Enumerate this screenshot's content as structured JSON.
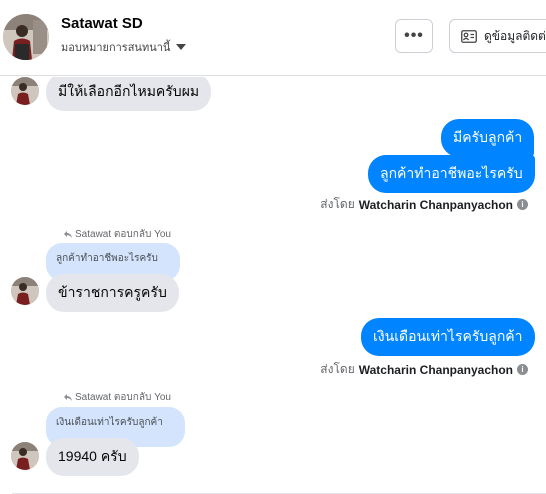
{
  "header": {
    "contact_name": "Satawat SD",
    "assign_label": "มอบหมายการสนทนานี้",
    "more_label": "•••",
    "contact_info_label": "ดูข้อมูลติดต่อ"
  },
  "messages": {
    "m1": "มีให้เลือกอีกไหมครับผม",
    "m2": "มีครับลูกค้า",
    "m3": "ลูกค้าทำอาชีพอะไรครับ",
    "sent1": {
      "prefix": "ส่งโดย",
      "agent": "Watcharin Chanpanyachon"
    },
    "reply1": {
      "tag": "Satawat ตอบกลับ You",
      "quote": "ลูกค้าทำอาชีพอะไรครับ",
      "text": "ข้าราชการครูครับ"
    },
    "m4": "เงินเดือนเท่าไรครับลูกค้า",
    "sent2": {
      "prefix": "ส่งโดย",
      "agent": "Watcharin Chanpanyachon"
    },
    "reply2": {
      "tag": "Satawat ตอบกลับ You",
      "quote": "เงินเดือนเท่าไรครับลูกค้า",
      "text": "19940 ครับ"
    }
  },
  "icons": {
    "info": "i",
    "reply_arrow": "reply-arrow-icon",
    "contact_card": "contact-card-icon"
  },
  "colors": {
    "outgoing_bubble": "#0084ff",
    "incoming_bubble": "#e4e6eb",
    "quote_bubble": "#d3e4fc"
  }
}
